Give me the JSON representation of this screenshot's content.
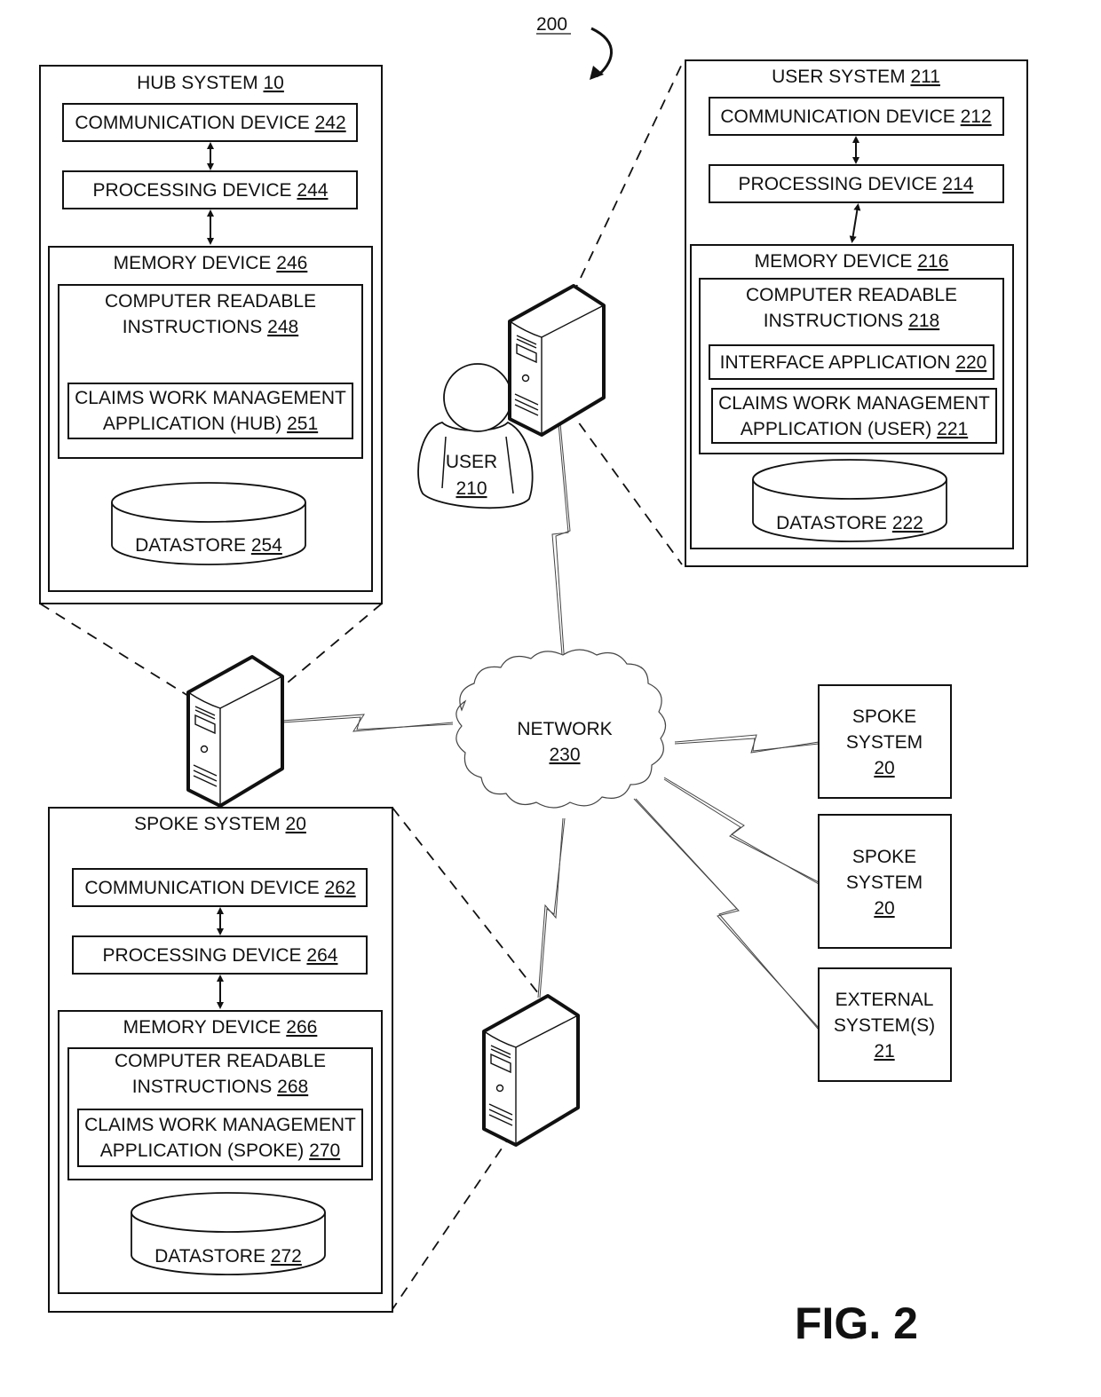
{
  "figure": {
    "ref_number": "200",
    "fig_label": "FIG. 2"
  },
  "hub_system": {
    "title": "HUB SYSTEM",
    "ref": "10",
    "communication_device": {
      "label": "COMMUNICATION DEVICE",
      "ref": "242"
    },
    "processing_device": {
      "label": "PROCESSING DEVICE",
      "ref": "244"
    },
    "memory_device": {
      "label": "MEMORY DEVICE",
      "ref": "246"
    },
    "instructions": {
      "line1": "COMPUTER READABLE",
      "line2": "INSTRUCTIONS",
      "ref": "248"
    },
    "application": {
      "line1": "CLAIMS WORK MANAGEMENT",
      "line2": "APPLICATION (HUB)",
      "ref": "251"
    },
    "datastore": {
      "label": "DATASTORE",
      "ref": "254"
    }
  },
  "user_system": {
    "title": "USER SYSTEM",
    "ref": "211",
    "communication_device": {
      "label": "COMMUNICATION DEVICE",
      "ref": "212"
    },
    "processing_device": {
      "label": "PROCESSING DEVICE",
      "ref": "214"
    },
    "memory_device": {
      "label": "MEMORY DEVICE",
      "ref": "216"
    },
    "instructions": {
      "line1": "COMPUTER READABLE",
      "line2": "INSTRUCTIONS",
      "ref": "218"
    },
    "interface_application": {
      "label": "INTERFACE APPLICATION",
      "ref": "220"
    },
    "application": {
      "line1": "CLAIMS WORK MANAGEMENT",
      "line2": "APPLICATION (USER)",
      "ref": "221"
    },
    "datastore": {
      "label": "DATASTORE",
      "ref": "222"
    }
  },
  "user": {
    "label": "USER",
    "ref": "210"
  },
  "network": {
    "label": "NETWORK",
    "ref": "230"
  },
  "spoke_system": {
    "title": "SPOKE SYSTEM",
    "ref": "20",
    "communication_device": {
      "label": "COMMUNICATION DEVICE",
      "ref": "262"
    },
    "processing_device": {
      "label": "PROCESSING DEVICE",
      "ref": "264"
    },
    "memory_device": {
      "label": "MEMORY DEVICE",
      "ref": "266"
    },
    "instructions": {
      "line1": "COMPUTER READABLE",
      "line2": "INSTRUCTIONS",
      "ref": "268"
    },
    "application": {
      "line1": "CLAIMS WORK MANAGEMENT",
      "line2": "APPLICATION (SPOKE)",
      "ref": "270"
    },
    "datastore": {
      "label": "DATASTORE",
      "ref": "272"
    }
  },
  "right_nodes": [
    {
      "line1": "SPOKE",
      "line2": "SYSTEM",
      "ref": "20"
    },
    {
      "line1": "SPOKE",
      "line2": "SYSTEM",
      "ref": "20"
    },
    {
      "line1": "EXTERNAL",
      "line2": "SYSTEM(S)",
      "ref": "21"
    }
  ],
  "icons": {
    "server": "server-tower-icon",
    "user": "person-icon",
    "network": "cloud-icon",
    "datastore": "database-cylinder-icon",
    "wireless_link": "lightning-link-icon",
    "bidirectional": "double-arrow-icon"
  }
}
